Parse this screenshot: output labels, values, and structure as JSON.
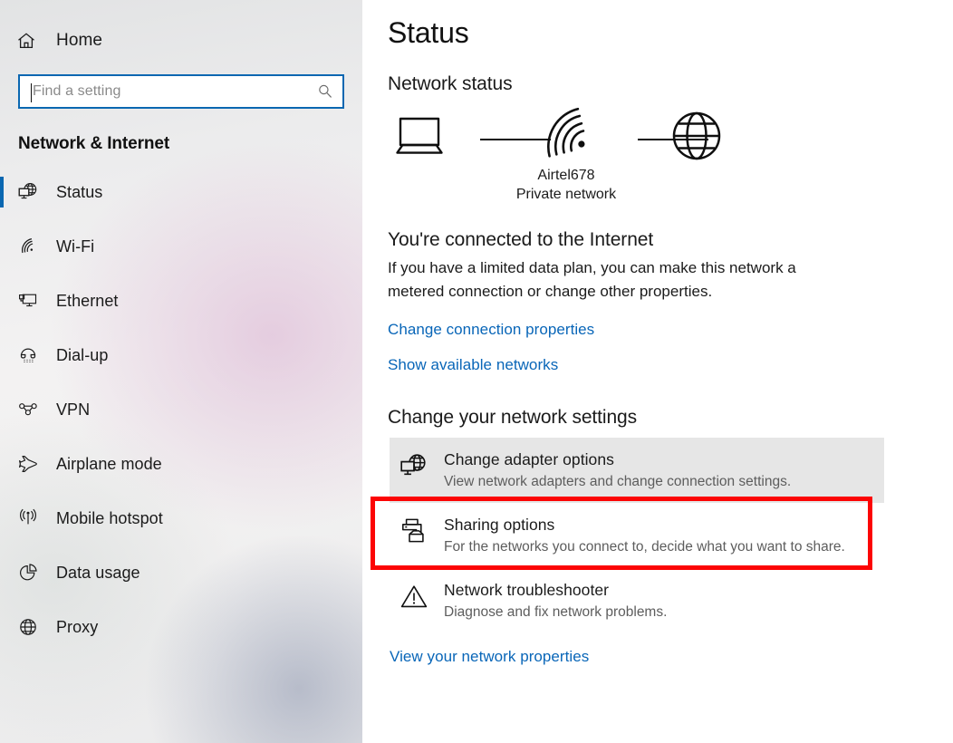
{
  "sidebar": {
    "home": {
      "label": "Home",
      "icon": "home-icon"
    },
    "search": {
      "value": "",
      "placeholder": "Find a setting",
      "icon": "search-icon"
    },
    "category_title": "Network & Internet",
    "items": [
      {
        "label": "Status",
        "icon": "globe-monitor-icon",
        "selected": true
      },
      {
        "label": "Wi-Fi",
        "icon": "wifi-icon",
        "selected": false
      },
      {
        "label": "Ethernet",
        "icon": "ethernet-icon",
        "selected": false
      },
      {
        "label": "Dial-up",
        "icon": "dialup-icon",
        "selected": false
      },
      {
        "label": "VPN",
        "icon": "vpn-icon",
        "selected": false
      },
      {
        "label": "Airplane mode",
        "icon": "airplane-icon",
        "selected": false
      },
      {
        "label": "Mobile hotspot",
        "icon": "hotspot-icon",
        "selected": false
      },
      {
        "label": "Data usage",
        "icon": "pie-chart-icon",
        "selected": false
      },
      {
        "label": "Proxy",
        "icon": "globe-icon",
        "selected": false
      }
    ]
  },
  "main": {
    "page_title": "Status",
    "network_status_heading": "Network status",
    "diagram": {
      "device_icon": "laptop-icon",
      "connection_icon": "wifi-signal-icon",
      "internet_icon": "globe-icon",
      "ssid": "Airtel678",
      "network_type": "Private network"
    },
    "connection_heading": "You're connected to the Internet",
    "connection_description": "If you have a limited data plan, you can make this network a metered connection or change other properties.",
    "links": {
      "change_connection_properties": "Change connection properties",
      "show_available_networks": "Show available networks",
      "view_network_properties": "View your network properties"
    },
    "settings_heading": "Change your network settings",
    "options": [
      {
        "title": "Change adapter options",
        "subtitle": "View network adapters and change connection settings.",
        "icon": "globe-monitor-icon",
        "hovered": true,
        "highlighted": true
      },
      {
        "title": "Sharing options",
        "subtitle": "For the networks you connect to, decide what you want to share.",
        "icon": "printer-folder-icon",
        "hovered": false,
        "highlighted": false
      },
      {
        "title": "Network troubleshooter",
        "subtitle": "Diagnose and fix network problems.",
        "icon": "warning-triangle-icon",
        "hovered": false,
        "highlighted": false
      }
    ]
  },
  "colors": {
    "accent_blue": "#0a67b1",
    "link_blue": "#0966b8",
    "highlight_red": "#fc0505",
    "hover_gray": "#e6e6e6",
    "text_primary": "#1b1b1b",
    "text_secondary": "#5d5d5d"
  }
}
